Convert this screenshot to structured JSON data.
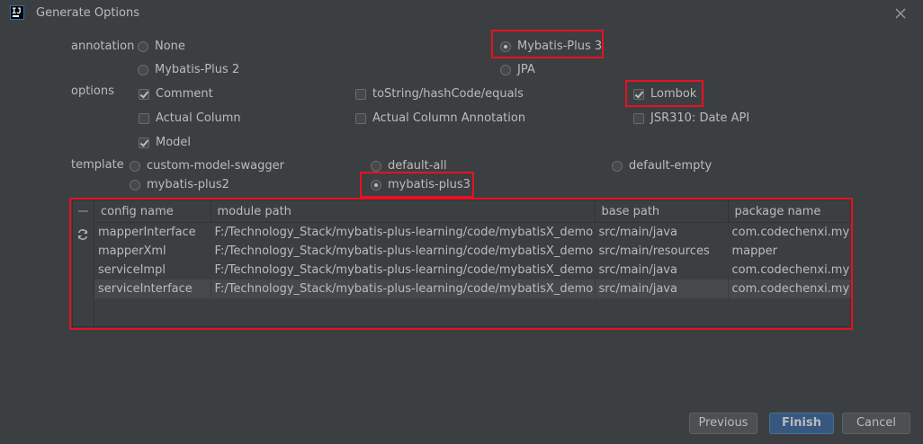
{
  "window": {
    "title": "Generate Options",
    "icon_text": "IJ"
  },
  "annotation": {
    "label": "annotation",
    "options": {
      "none": "None",
      "mybatis_plus_3": "Mybatis-Plus 3",
      "mybatis_plus_2": "Mybatis-Plus 2",
      "jpa": "JPA"
    },
    "selected": "Mybatis-Plus 3"
  },
  "options": {
    "label": "options",
    "comment": {
      "label": "Comment",
      "checked": true
    },
    "tostring": {
      "label": "toString/hashCode/equals",
      "checked": false
    },
    "lombok": {
      "label": "Lombok",
      "checked": true
    },
    "actual_column": {
      "label": "Actual Column",
      "checked": false
    },
    "actual_column_annotation": {
      "label": "Actual Column Annotation",
      "checked": false
    },
    "jsr310": {
      "label": "JSR310: Date API",
      "checked": false
    },
    "model": {
      "label": "Model",
      "checked": true
    }
  },
  "template": {
    "label": "template",
    "options": {
      "custom_model_swagger": "custom-model-swagger",
      "default_all": "default-all",
      "default_empty": "default-empty",
      "mybatis_plus2": "mybatis-plus2",
      "mybatis_plus3": "mybatis-plus3"
    },
    "selected": "mybatis-plus3"
  },
  "table": {
    "columns": {
      "config_name": "config name",
      "module_path": "module path",
      "base_path": "base path",
      "package_name": "package name"
    },
    "rows": [
      {
        "config_name": "mapperInterface",
        "module_path": "F:/Technology_Stack/mybatis-plus-learning/code/mybatisX_demo",
        "base_path": "src/main/java",
        "package_name": "com.codechenxi.mybat"
      },
      {
        "config_name": "mapperXml",
        "module_path": "F:/Technology_Stack/mybatis-plus-learning/code/mybatisX_demo",
        "base_path": "src/main/resources",
        "package_name": "mapper"
      },
      {
        "config_name": "serviceImpl",
        "module_path": "F:/Technology_Stack/mybatis-plus-learning/code/mybatisX_demo",
        "base_path": "src/main/java",
        "package_name": "com.codechenxi.mybat"
      },
      {
        "config_name": "serviceInterface",
        "module_path": "F:/Technology_Stack/mybatis-plus-learning/code/mybatisX_demo",
        "base_path": "src/main/java",
        "package_name": "com.codechenxi.mybat"
      }
    ]
  },
  "buttons": {
    "previous": "Previous",
    "finish": "Finish",
    "cancel": "Cancel"
  },
  "colors": {
    "background": "#3c3f41",
    "text": "#bbbbbb",
    "highlight": "#e81123",
    "primary_button": "#365880"
  }
}
